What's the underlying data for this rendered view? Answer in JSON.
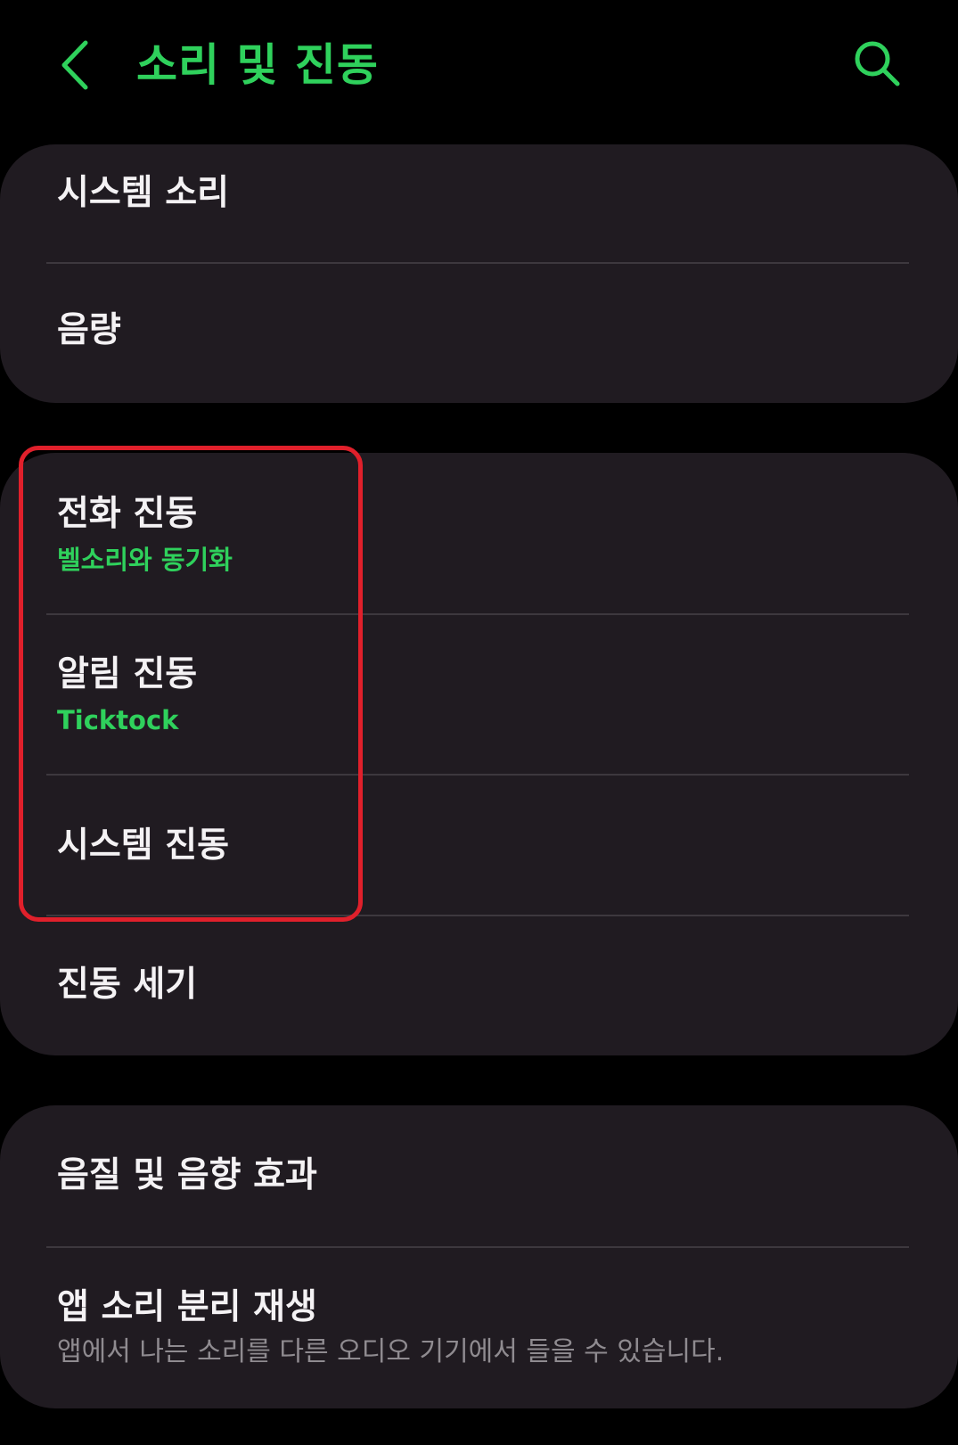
{
  "header": {
    "title": "소리 및 진동",
    "back_icon": "chevron-left-icon",
    "search_icon": "search-icon"
  },
  "colors": {
    "accent": "#2fd15c",
    "card_bg": "#201b21",
    "highlight": "#e0202b"
  },
  "group1": {
    "items": [
      {
        "title": "시스템 소리"
      },
      {
        "title": "음량"
      }
    ]
  },
  "group2": {
    "items": [
      {
        "title": "전화 진동",
        "subtitle": "벨소리와 동기화"
      },
      {
        "title": "알림 진동",
        "subtitle": "Ticktock"
      },
      {
        "title": "시스템 진동"
      },
      {
        "title": "진동 세기"
      }
    ]
  },
  "group3": {
    "items": [
      {
        "title": "음질 및 음향 효과"
      },
      {
        "title": "앱 소리 분리 재생",
        "subtitle": "앱에서 나는 소리를 다른 오디오 기기에서 들을 수 있습니다."
      }
    ]
  }
}
